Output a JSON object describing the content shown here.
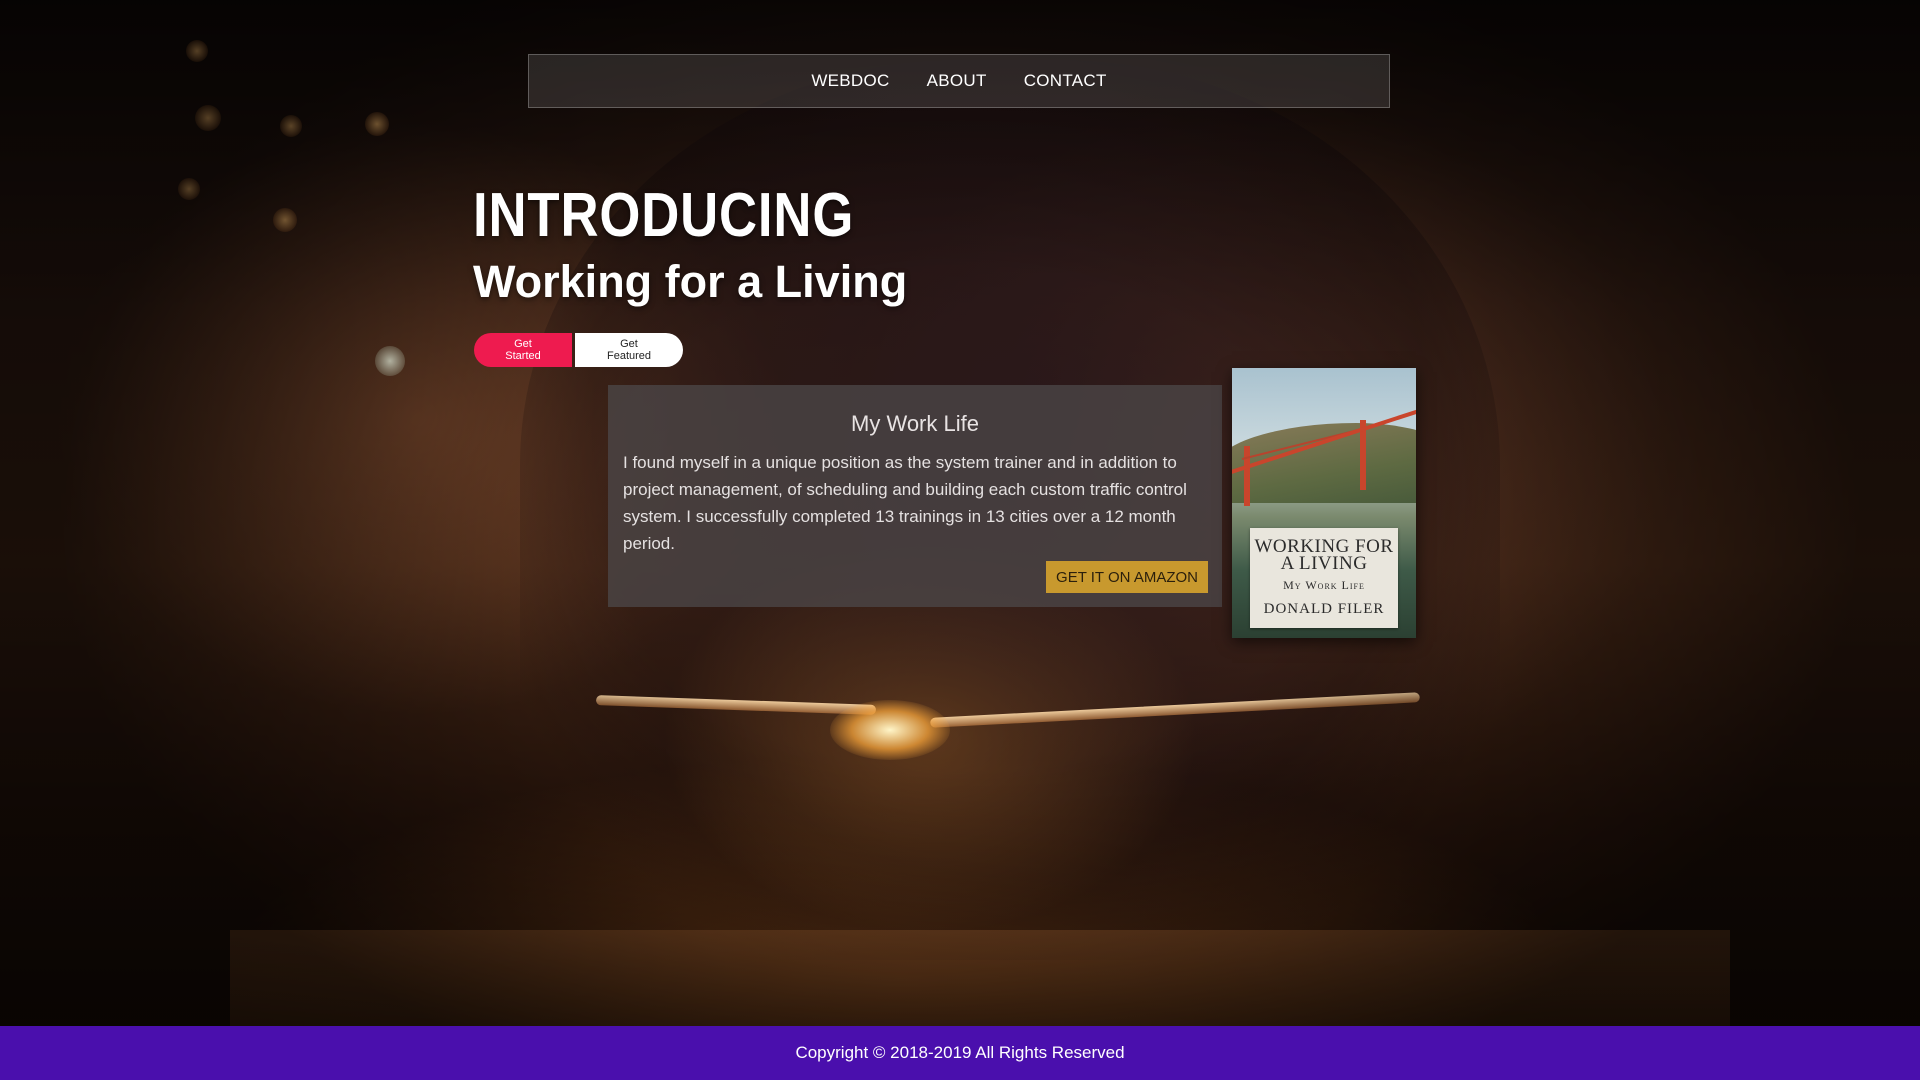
{
  "nav": {
    "items": [
      {
        "label": "WEBDOC"
      },
      {
        "label": "ABOUT"
      },
      {
        "label": "CONTACT"
      }
    ]
  },
  "hero": {
    "heading": "INTRODUCING",
    "subheading": "Working for a Living",
    "primary_button": "Get Started",
    "secondary_button": "Get Featured"
  },
  "card": {
    "title": "My Work Life",
    "body": "I found myself in a unique position as the system trainer and in addition to project management, of scheduling and building each custom traffic control system. I successfully completed 13 trainings in 13 cities over a 12 month period.",
    "cta": "GET IT ON AMAZON"
  },
  "book": {
    "title": "WORKING FOR A LIVING",
    "subtitle": "My Work Life",
    "author": "DONALD FILER"
  },
  "footer": {
    "copyright": "Copyright © 2018-2019 All Rights Reserved"
  },
  "colors": {
    "primary_button": "#ee1b4f",
    "amazon_button": "#c8992e",
    "footer_bg": "#4a0fad"
  }
}
